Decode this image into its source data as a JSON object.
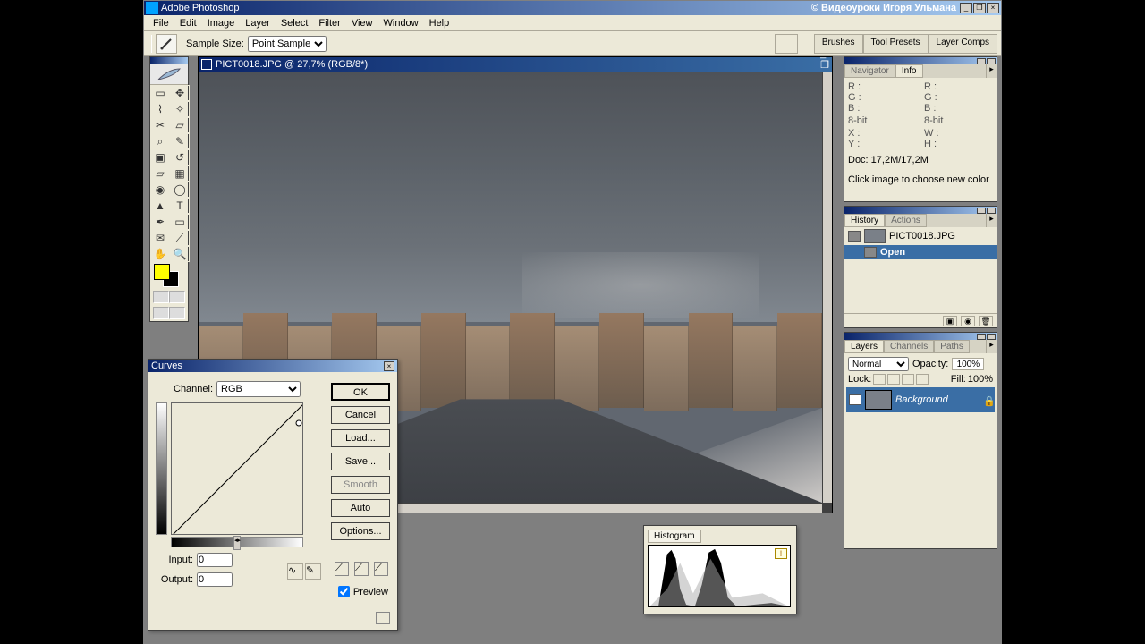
{
  "app": {
    "title": "Adobe Photoshop",
    "tutorial_label": "© Видеоуроки Игоря Ульмана"
  },
  "menu": [
    "File",
    "Edit",
    "Image",
    "Layer",
    "Select",
    "Filter",
    "View",
    "Window",
    "Help"
  ],
  "options_bar": {
    "sample_size_label": "Sample Size:",
    "sample_size_value": "Point Sample",
    "right_tabs": [
      "Brushes",
      "Tool Presets",
      "Layer Comps"
    ]
  },
  "document": {
    "title": "PICT0018.JPG @ 27,7% (RGB/8*)"
  },
  "curves": {
    "title": "Curves",
    "channel_label": "Channel:",
    "channel_value": "RGB",
    "input_label": "Input:",
    "input_value": "0",
    "output_label": "Output:",
    "output_value": "0",
    "buttons": {
      "ok": "OK",
      "cancel": "Cancel",
      "load": "Load...",
      "save": "Save...",
      "smooth": "Smooth",
      "auto": "Auto",
      "options": "Options..."
    },
    "preview_label": "Preview"
  },
  "histogram_panel": {
    "tab": "Histogram"
  },
  "info_panel": {
    "tabs": [
      "Navigator",
      "Info"
    ],
    "rgb_labels": {
      "r": "R :",
      "g": "G :",
      "b": "B :"
    },
    "bit_depth": "8-bit",
    "xy": {
      "x": "X :",
      "y": "Y :"
    },
    "wh": {
      "w": "W :",
      "h": "H :"
    },
    "doc_size": "Doc: 17,2M/17,2M",
    "hint": "Click image to choose new color"
  },
  "history_panel": {
    "tabs": [
      "History",
      "Actions"
    ],
    "file_name": "PICT0018.JPG",
    "states": [
      "Open"
    ]
  },
  "layers_panel": {
    "tabs": [
      "Layers",
      "Channels",
      "Paths"
    ],
    "blend_mode": "Normal",
    "opacity_label": "Opacity:",
    "opacity_value": "100%",
    "lock_label": "Lock:",
    "fill_label": "Fill:",
    "fill_value": "100%",
    "layer_name": "Background"
  },
  "colors": {
    "foreground": "#ffff00",
    "background": "#000000"
  }
}
